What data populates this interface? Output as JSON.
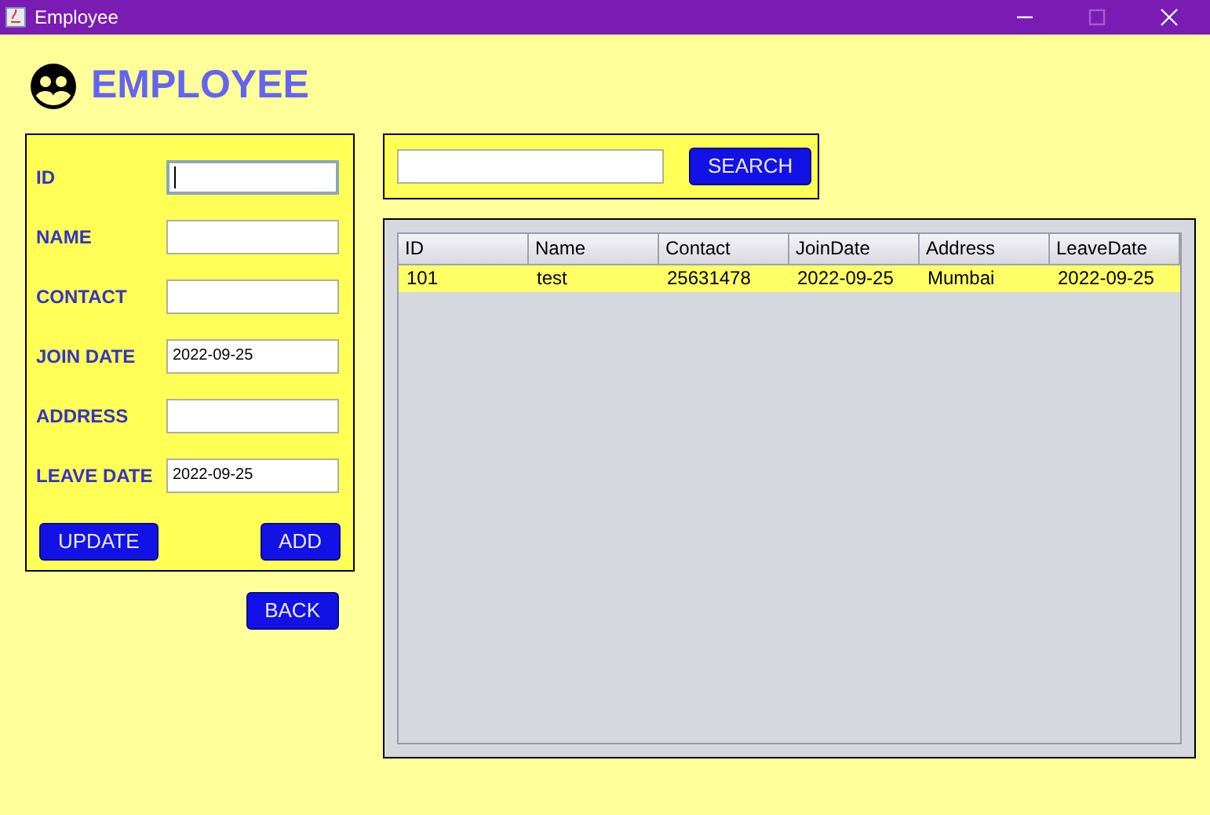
{
  "window": {
    "title": "Employee",
    "controls": [
      {
        "kind": "minimize",
        "disabled": false
      },
      {
        "kind": "maximize",
        "disabled": true
      },
      {
        "kind": "close",
        "disabled": false
      }
    ]
  },
  "heading": "EMPLOYEE",
  "form": {
    "fields": [
      {
        "label": "ID",
        "focused": true
      },
      {
        "label": "NAME",
        "focused": false
      },
      {
        "label": "CONTACT",
        "focused": false
      },
      {
        "label": "JOIN DATE",
        "value": "2022-09-25",
        "focused": false
      },
      {
        "label": "ADDRESS",
        "focused": false
      },
      {
        "label": "LEAVE DATE",
        "value": "2022-09-25",
        "focused": false
      }
    ],
    "buttons": [
      "UPDATE",
      "ADD"
    ]
  },
  "back_button": "BACK",
  "search": {
    "button": "SEARCH"
  },
  "table": {
    "columns": [
      "ID",
      "Name",
      "Contact",
      "JoinDate",
      "Address",
      "LeaveDate"
    ],
    "rows": [
      {
        "cells": [
          "101",
          "test",
          "25631478",
          "2022-09-25",
          "Mumbai",
          "2022-09-25"
        ],
        "selected": true
      }
    ]
  }
}
